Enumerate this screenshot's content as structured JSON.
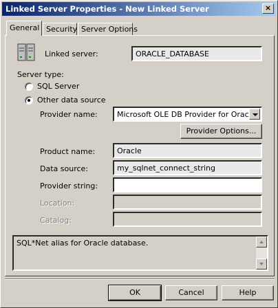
{
  "window": {
    "title": "Linked Server Properties - New Linked Server",
    "close_label": "×"
  },
  "tabs": [
    {
      "label": "General",
      "active": true
    },
    {
      "label": "Security",
      "active": false
    },
    {
      "label": "Server Options",
      "active": false
    }
  ],
  "general": {
    "linked_server_label": "Linked server:",
    "linked_server_value": "ORACLE_DATABASE",
    "server_type_label": "Server type:",
    "sql_server_label": "SQL Server",
    "sql_server_checked": false,
    "other_source_label": "Other data source",
    "other_source_checked": true,
    "provider_name_label": "Provider name:",
    "provider_name_value": "Microsoft OLE DB Provider for Oracle",
    "provider_options_button": "Provider Options...",
    "product_name_label": "Product name:",
    "product_name_value": "Oracle",
    "data_source_label": "Data source:",
    "data_source_value": "my_sqlnet_connect_string",
    "provider_string_label": "Provider string:",
    "provider_string_value": "",
    "location_label": "Location:",
    "location_value": "",
    "catalog_label": "Catalog:",
    "catalog_value": "",
    "description": "SQL*Net alias for Oracle database."
  },
  "buttons": {
    "ok": "OK",
    "cancel": "Cancel",
    "help": "Help"
  },
  "icons": {
    "server": "server-icon"
  }
}
